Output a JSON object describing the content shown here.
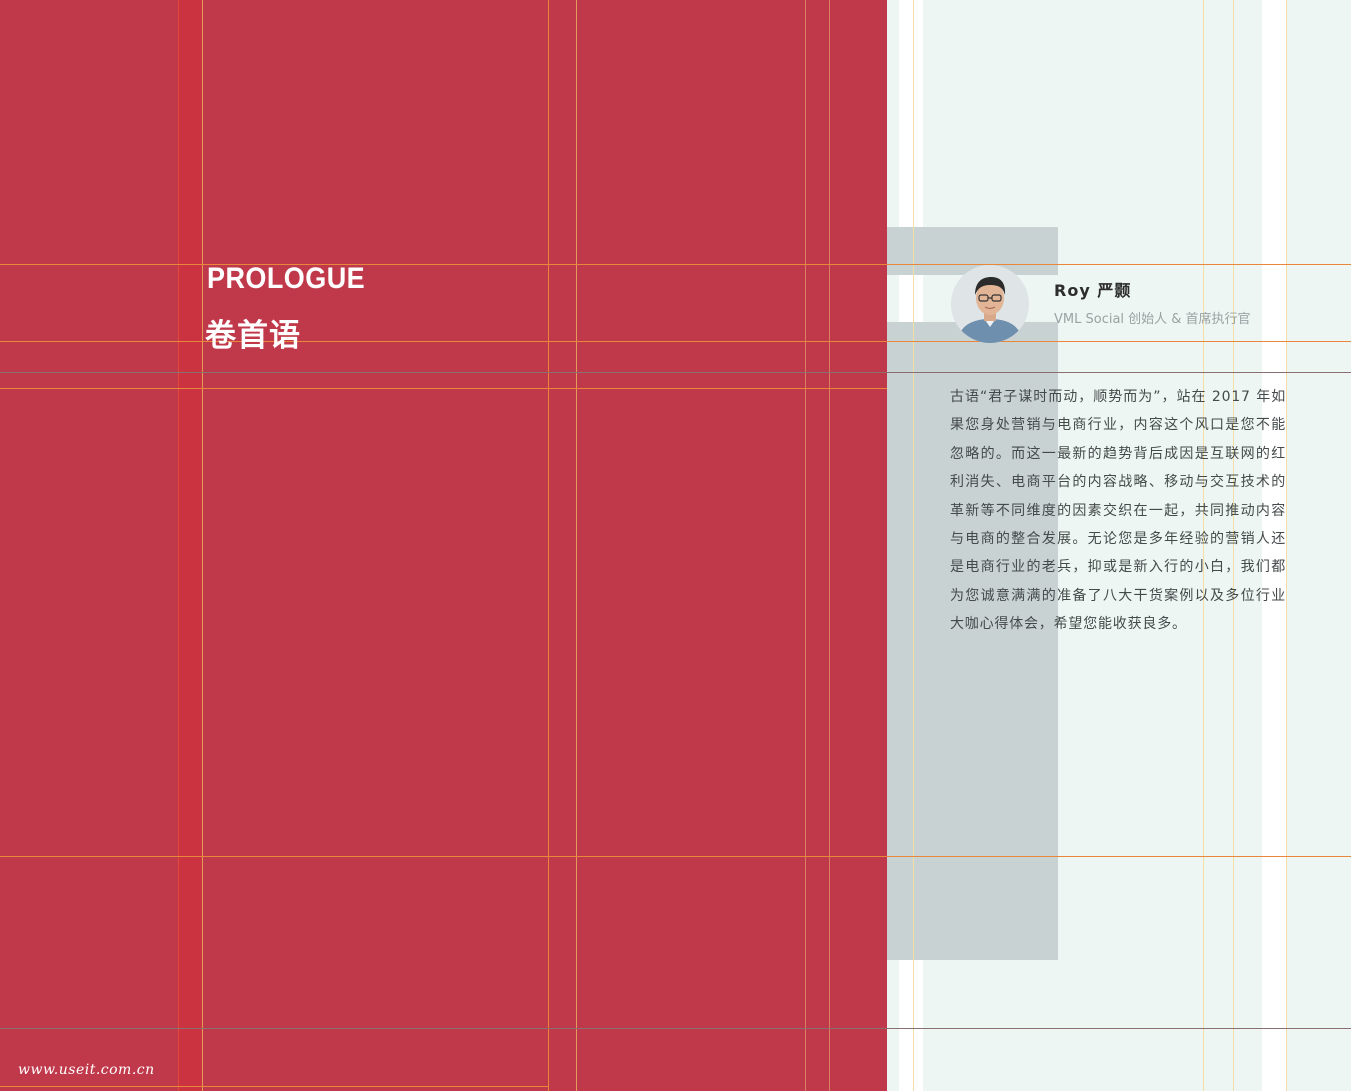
{
  "heading": {
    "title_en": "PROLOGUE",
    "title_zh": "卷首语"
  },
  "author": {
    "name": "Roy 严颢",
    "role": "VML Social 创始人 & 首席执行官",
    "avatar_icon": "person-portrait-icon"
  },
  "body": {
    "paragraph": "古语“君子谋时而动，顺势而为”，站在 2017 年如果您身处营销与电商行业，内容这个风口是您不能忽略的。而这一最新的趋势背后成因是互联网的红利消失、电商平台的内容战略、移动与交互技术的革新等不同维度的因素交织在一起，共同推动内容与电商的整合发展。无论您是多年经验的营销人还是电商行业的老兵，抑或是新入行的小白，我们都为您诚意满满的准备了八大干货案例以及多位行业大咖心得体会，希望您能收获良多。"
  },
  "watermark": {
    "text": "www.useit.com.cn"
  },
  "colors": {
    "left_page": "#c0394b",
    "left_stripe": "#cb3340",
    "right_page": "#eef6f3",
    "gray_block": "#c8d2d2",
    "guide_orange": "#e8873a",
    "guide_yellow": "#f3dfa6"
  }
}
